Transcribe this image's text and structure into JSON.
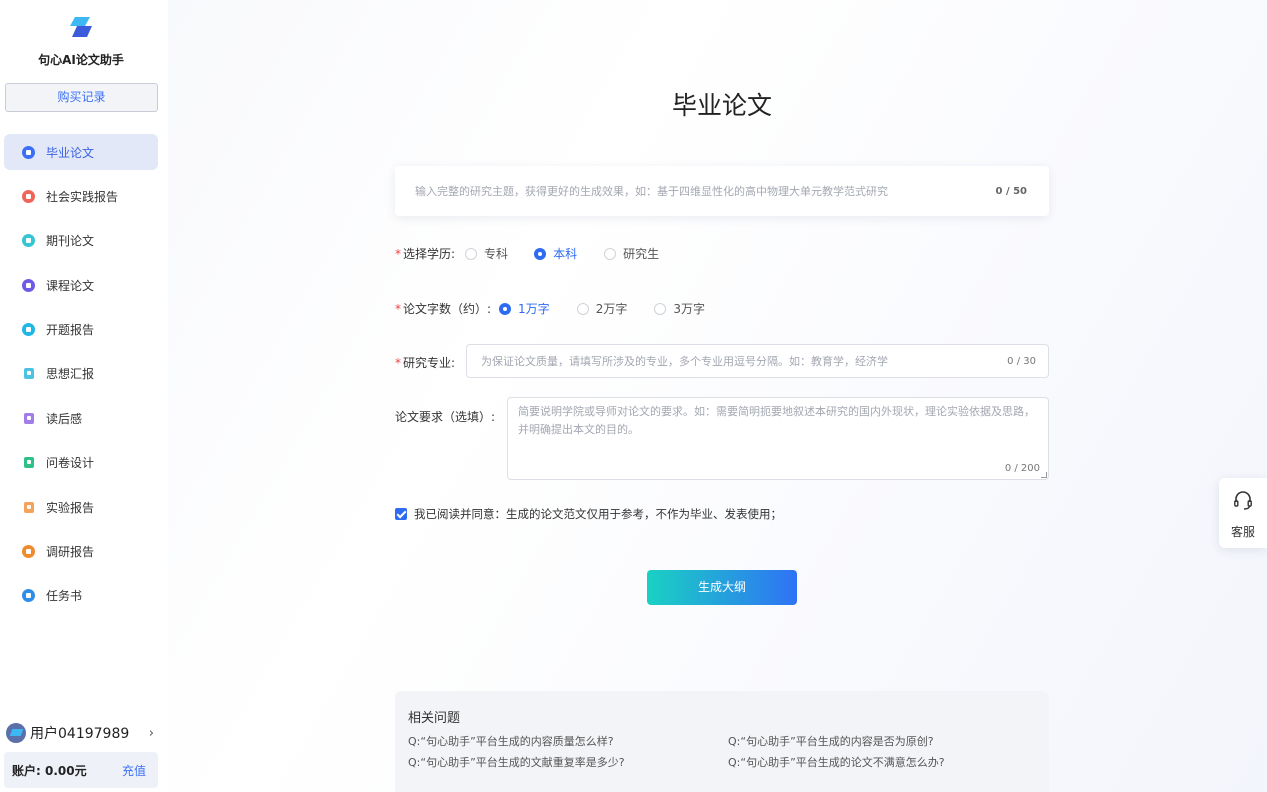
{
  "app": {
    "name": "句心AI论文助手"
  },
  "sidebar": {
    "buy_records": "购买记录",
    "items": [
      {
        "label": "毕业论文",
        "color": "#3b6ff5",
        "shape": "circle",
        "active": true
      },
      {
        "label": "社会实践报告",
        "color": "#f0645a",
        "shape": "circle"
      },
      {
        "label": "期刊论文",
        "color": "#36c6d3",
        "shape": "circle"
      },
      {
        "label": "课程论文",
        "color": "#6f5ce6",
        "shape": "circle"
      },
      {
        "label": "开题报告",
        "color": "#1fb6e8",
        "shape": "circle"
      },
      {
        "label": "思想汇报",
        "color": "#4cc3e0",
        "shape": "square"
      },
      {
        "label": "读后感",
        "color": "#a07de8",
        "shape": "square"
      },
      {
        "label": "问卷设计",
        "color": "#2fc08a",
        "shape": "square"
      },
      {
        "label": "实验报告",
        "color": "#f5a35a",
        "shape": "square"
      },
      {
        "label": "调研报告",
        "color": "#f08a2e",
        "shape": "circle"
      },
      {
        "label": "任务书",
        "color": "#2e8de8",
        "shape": "circle"
      }
    ],
    "user": {
      "name": "用户04197989",
      "arrow": "›"
    },
    "account": {
      "balance_label": "账户: 0.00元",
      "recharge": "充值"
    }
  },
  "main": {
    "title": "毕业论文",
    "topic": {
      "placeholder": "输入完整的研究主题，获得更好的生成效果，如：基于四维显性化的高中物理大单元教学范式研究",
      "counter": "0 / 50"
    },
    "education": {
      "label": "选择学历:",
      "options": [
        "专科",
        "本科",
        "研究生"
      ],
      "selected": "本科"
    },
    "word_count": {
      "label": "论文字数（约）:",
      "options": [
        "1万字",
        "2万字",
        "3万字"
      ],
      "selected": "1万字"
    },
    "major": {
      "label": "研究专业:",
      "placeholder": "为保证论文质量，请填写所涉及的专业，多个专业用逗号分隔。如：教育学，经济学",
      "counter": "0 / 30"
    },
    "requirements": {
      "label": "论文要求（选填）:",
      "placeholder": "简要说明学院或导师对论文的要求。如：需要简明扼要地叙述本研究的国内外现状，理论实验依据及思路，并明确提出本文的目的。",
      "counter": "0 / 200"
    },
    "agreement": {
      "checked": true,
      "text": "我已阅读并同意：生成的论文范文仅用于参考，不作为毕业、发表使用；"
    },
    "generate_button": "生成大纲",
    "faq": {
      "title": "相关问题",
      "questions": [
        "Q:“句心助手”平台生成的内容质量怎么样?",
        "Q:“句心助手”平台生成的内容是否为原创?",
        "Q:“句心助手”平台生成的文献重复率是多少?",
        "Q:“句心助手”平台生成的论文不满意怎么办?"
      ]
    }
  },
  "service": {
    "label": "客服",
    "icon": "headset-icon"
  },
  "colors": {
    "accent": "#2f6bf2",
    "button_gradient_start": "#1ad1c3",
    "button_gradient_end": "#2f72f5"
  }
}
